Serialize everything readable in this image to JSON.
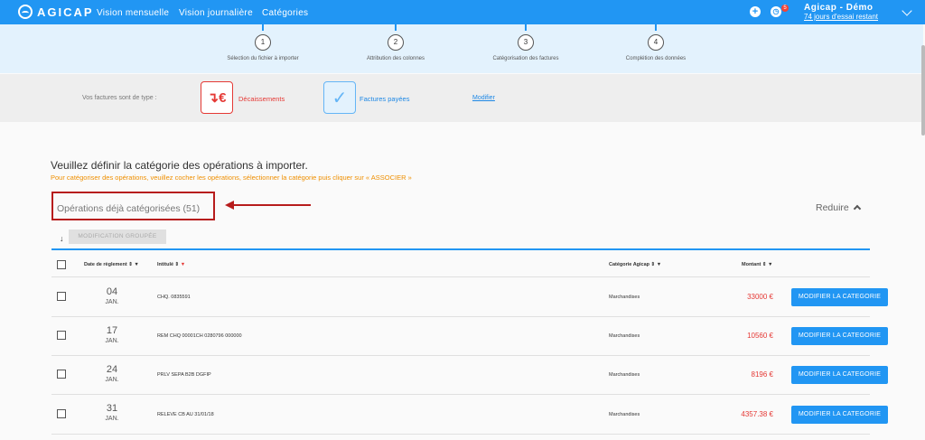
{
  "nav": {
    "brand": "AGICAP",
    "items": [
      "Vision mensuelle",
      "Vision journalière",
      "Catégories"
    ],
    "notifications": "5",
    "user": "Agicap - Démo",
    "trial": "74 jours d'essai restant"
  },
  "steps": [
    {
      "num": "1",
      "label": "Sélection du fichier à importer"
    },
    {
      "num": "2",
      "label": "Attribution des colonnes"
    },
    {
      "num": "3",
      "label": "Catégorisation des factures"
    },
    {
      "num": "4",
      "label": "Complétion des données"
    }
  ],
  "type_band": {
    "label": "Vos factures sont de type :",
    "option1_icon": "↴€",
    "option1": "Décaissements",
    "option2": "Factures payées",
    "modify_link": "Modifier"
  },
  "main": {
    "heading": "Veuillez définir la catégorie des opérations à importer.",
    "subheading": "Pour catégoriser des opérations, veuillez cocher les opérations, sélectionner la catégorie puis cliquer sur « ASSOCIER »",
    "section_title": "Opérations déjà catégorisées (51)",
    "collapse": "Reduire",
    "group_button": "MODIFICATION GROUPÉE"
  },
  "table": {
    "headers": {
      "date": "Date de règlement ⇕ ▼",
      "label": "Intitulé ⇕",
      "label_filter": "▼",
      "category": "Catégorie Agicap ⇕ ▼",
      "amount": "Montant ⇕ ▼"
    },
    "rows": [
      {
        "day": "04",
        "month": "JAN.",
        "label": "CHQ. 0835591",
        "category": "Marchandises",
        "amount": "33000 €",
        "button": "MODIFIER LA CATEGORIE"
      },
      {
        "day": "17",
        "month": "JAN.",
        "label": "REM CHQ 00001CH 0280796 000000",
        "category": "Marchandises",
        "amount": "10560 €",
        "button": "MODIFIER LA CATEGORIE"
      },
      {
        "day": "24",
        "month": "JAN.",
        "label": "PRLV SEPA B2B DGFIP",
        "category": "Marchandises",
        "amount": "8196 €",
        "button": "MODIFIER LA CATEGORIE"
      },
      {
        "day": "31",
        "month": "JAN.",
        "label": "RELEVE CB AU 31/01/18",
        "category": "Marchandises",
        "amount": "4357.38 €",
        "button": "MODIFIER LA CATEGORIE"
      }
    ]
  },
  "colors": {
    "primary": "#2196f3",
    "danger": "#e53935",
    "warning": "#ef8f00",
    "annotation": "#b71c1c"
  }
}
